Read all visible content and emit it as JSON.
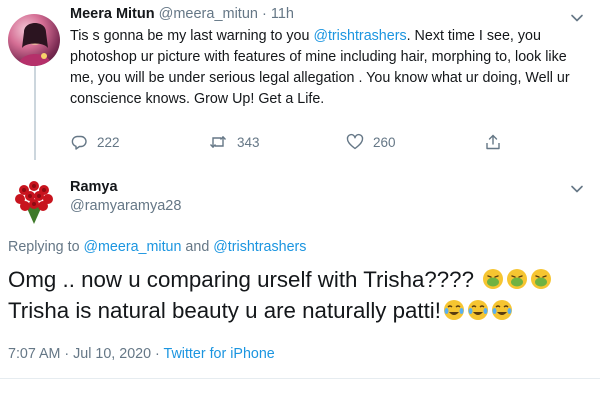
{
  "parent_tweet": {
    "author_name": "Meera Mitun",
    "author_handle": "@meera_mitun",
    "separator": "·",
    "time": "11h",
    "text_before": "Tis s gonna be my last warning to you ",
    "mention": "@trishtrashers",
    "text_after": ". Next time I see, you photoshop ur picture with features of mine including hair, morphing to, look like me, you will be under serious legal allegation . You know what ur doing, Well ur conscience knows. Grow Up! Get a Life.",
    "replies": "222",
    "retweets": "343",
    "likes": "260"
  },
  "reply_tweet": {
    "author_name": "Ramya",
    "author_handle": "@ramyaramya28",
    "replying_prefix": "Replying to ",
    "replying_mention_1": "@meera_mitun",
    "replying_and": " and ",
    "replying_mention_2": "@trishtrashers",
    "line1": "Omg .. now u comparing urself with Trisha????",
    "line2": "Trisha is natural beauty u are naturally patti!",
    "timestamp": "7:07 AM · Jul 10, 2020 · ",
    "source": "Twitter for iPhone"
  },
  "colors": {
    "link": "#1b95e0",
    "secondary_text": "#657786",
    "primary_text": "#14171a",
    "thread_line": "#ccd6dd"
  },
  "icons": [
    "reply-icon",
    "retweet-icon",
    "like-icon",
    "share-icon",
    "chevron-down-icon",
    "nauseated-face-icon",
    "tears-of-joy-icon"
  ]
}
